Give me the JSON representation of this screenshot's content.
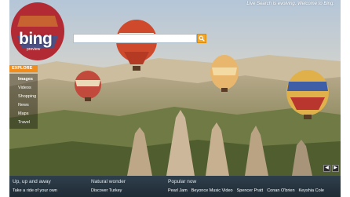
{
  "header": {
    "logo": "bing",
    "logo_sub": "preview",
    "top_message": "Live Search is evolving. Welcome to Bing."
  },
  "search": {
    "value": "",
    "placeholder": ""
  },
  "nav": {
    "explore_label": "EXPLORE",
    "items": [
      {
        "label": "Images"
      },
      {
        "label": "Videos"
      },
      {
        "label": "Shopping"
      },
      {
        "label": "News"
      },
      {
        "label": "Maps"
      },
      {
        "label": "Travel"
      }
    ]
  },
  "footer": {
    "col1": {
      "title": "Up, up and away",
      "link": "Take a ride of your own"
    },
    "col2": {
      "title": "Natural wonder",
      "link": "Discover Turkey"
    },
    "col3": {
      "title": "Popular now",
      "links": [
        "Pearl Jam",
        "Beyonce Music Video",
        "Spencer Pratt",
        "Conan O'brien",
        "Keyshia Cole"
      ]
    }
  },
  "colors": {
    "explore": "#f08d1c",
    "search_button": "#f5a623",
    "footer": "#2f3f4c"
  },
  "icons": {
    "search": "magnifier-icon",
    "prev": "chevron-left-icon",
    "next": "chevron-right-icon"
  }
}
